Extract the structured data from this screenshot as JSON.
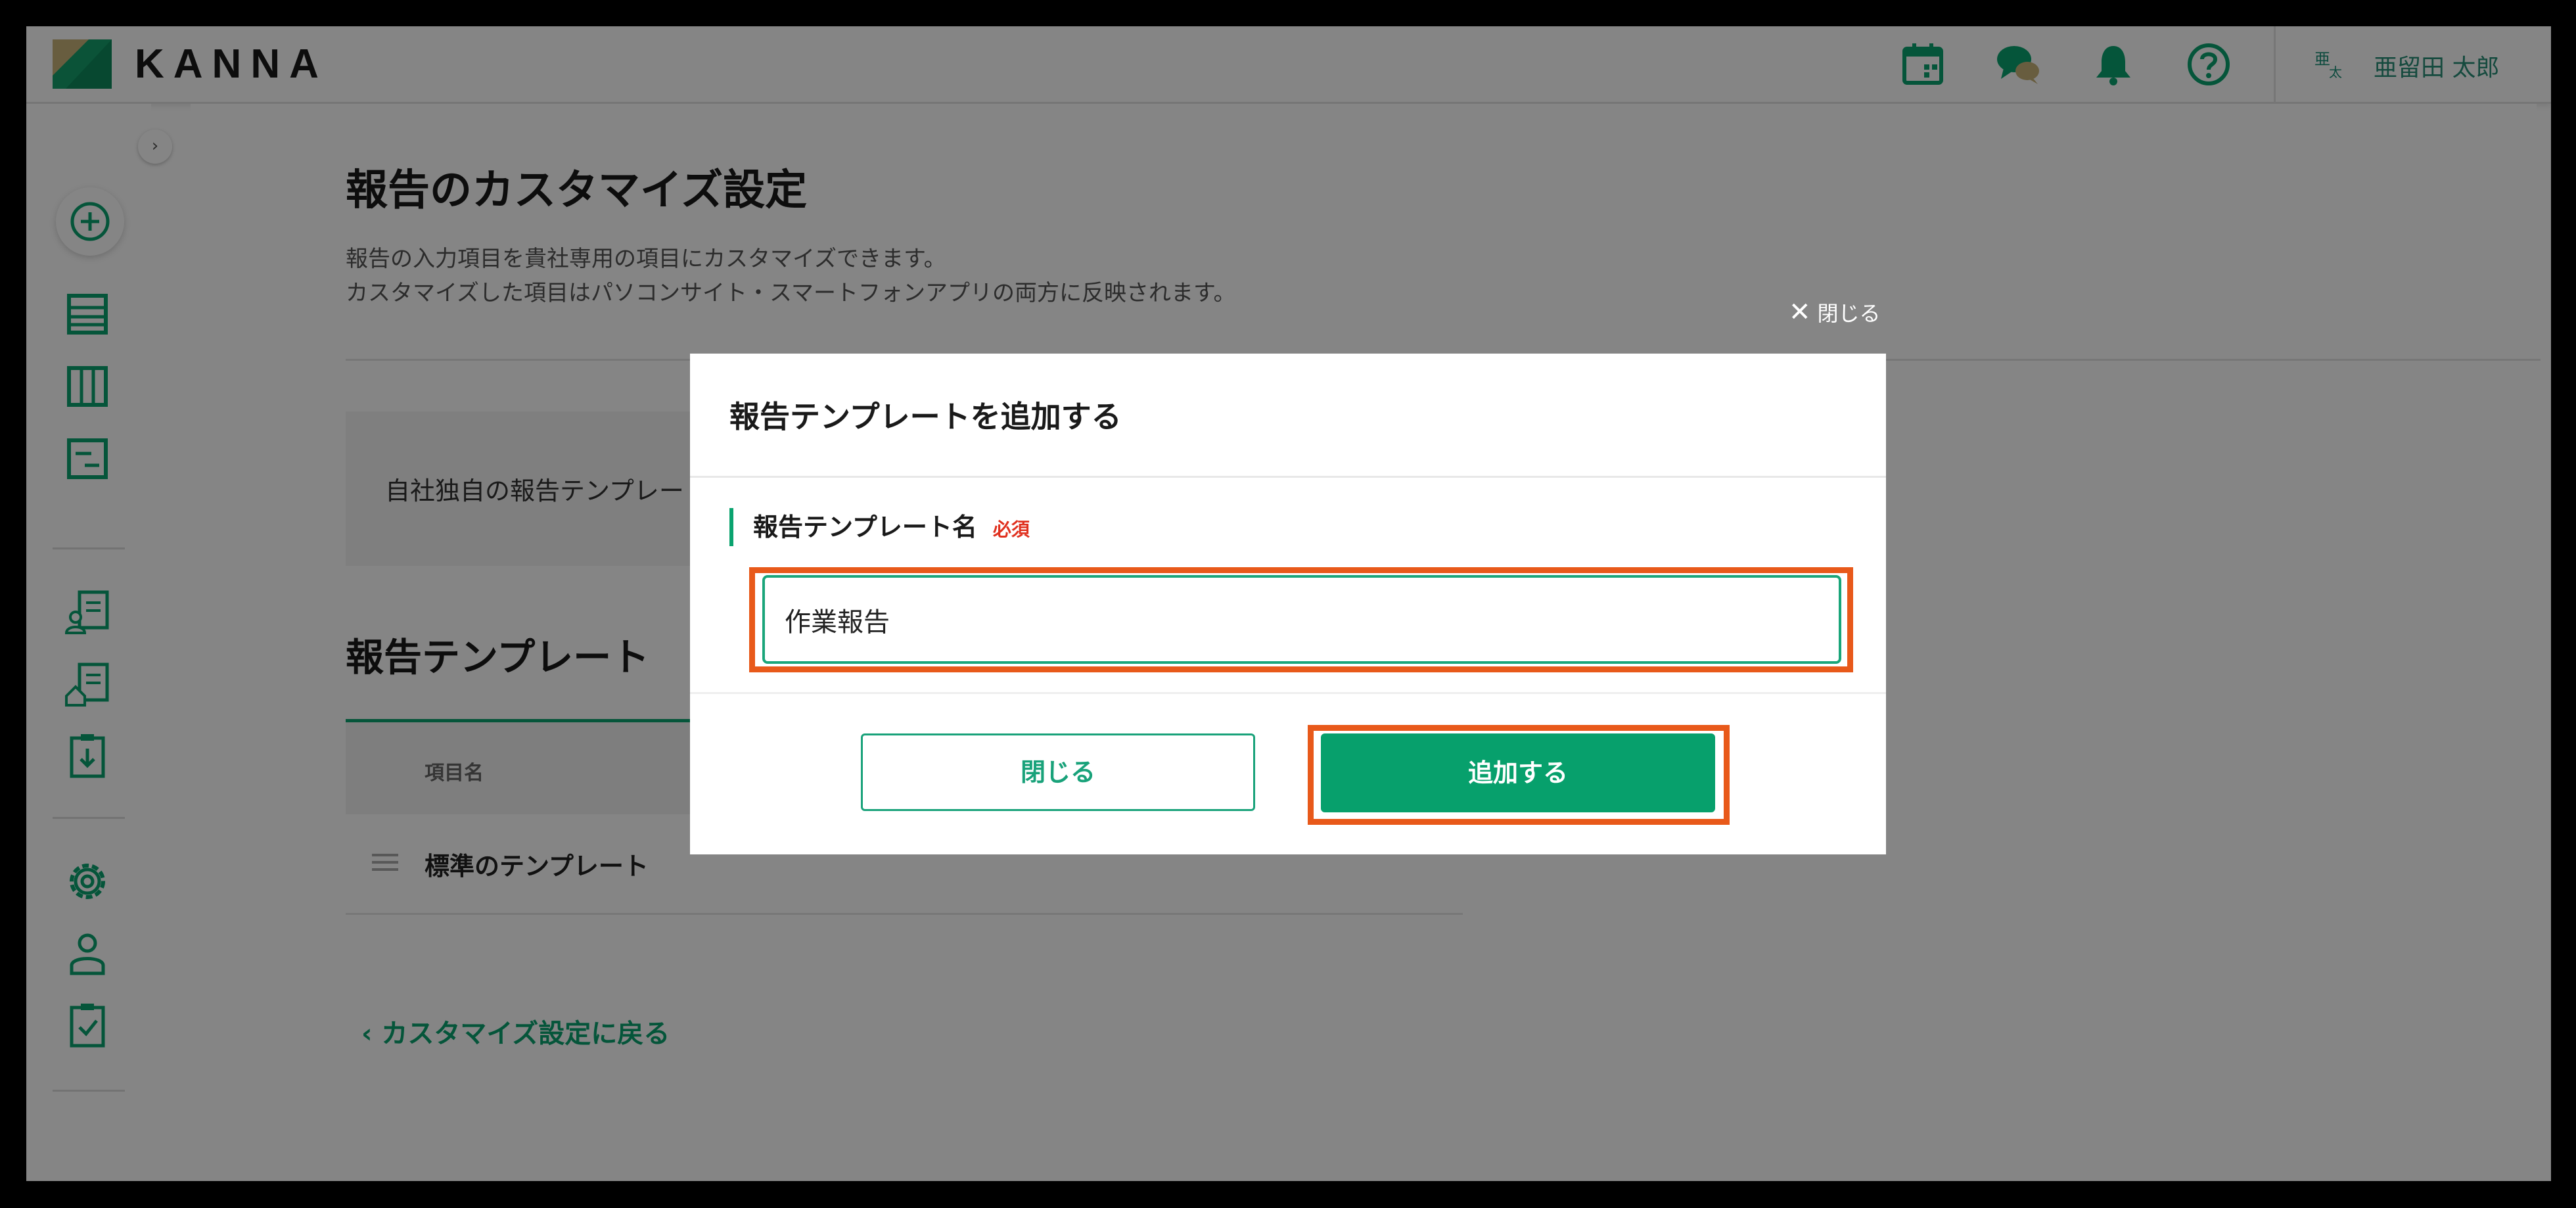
{
  "app": {
    "brand": "KANNA",
    "username": "亜留田 太郎",
    "avatar_chars": [
      "亜",
      "太"
    ]
  },
  "header_icons": [
    "calendar-icon",
    "chat-icon",
    "bell-icon",
    "help-icon"
  ],
  "sidebar_icons": [
    "plus-circle-icon",
    "list-icon",
    "columns-icon",
    "report-icon",
    "document-person-icon",
    "document-house-icon",
    "download-clipboard-icon",
    "gear-icon",
    "person-icon",
    "clipboard-check-icon"
  ],
  "page": {
    "title": "報告のカスタマイズ設定",
    "desc1": "報告の入力項目を貴社専用の項目にカスタマイズできます。",
    "desc2": "カスタマイズした項目はパソコンサイト・スマートフォンアプリの両方に反映されます。",
    "info_text": "自社独自の報告テンプレート",
    "section_title": "報告テンプレート",
    "table_col_name": "項目名",
    "table_rows": [
      {
        "name": "標準のテンプレート"
      }
    ],
    "back_link": "カスタマイズ設定に戻る"
  },
  "modal": {
    "close_link": "閉じる",
    "title": "報告テンプレートを追加する",
    "field_label": "報告テンプレート名",
    "required_badge": "必須",
    "input_value": "作業報告",
    "cancel_label": "閉じる",
    "submit_label": "追加する"
  },
  "colors": {
    "accent": "#07a06c",
    "highlight": "#e8591a",
    "required": "#e0301e"
  }
}
